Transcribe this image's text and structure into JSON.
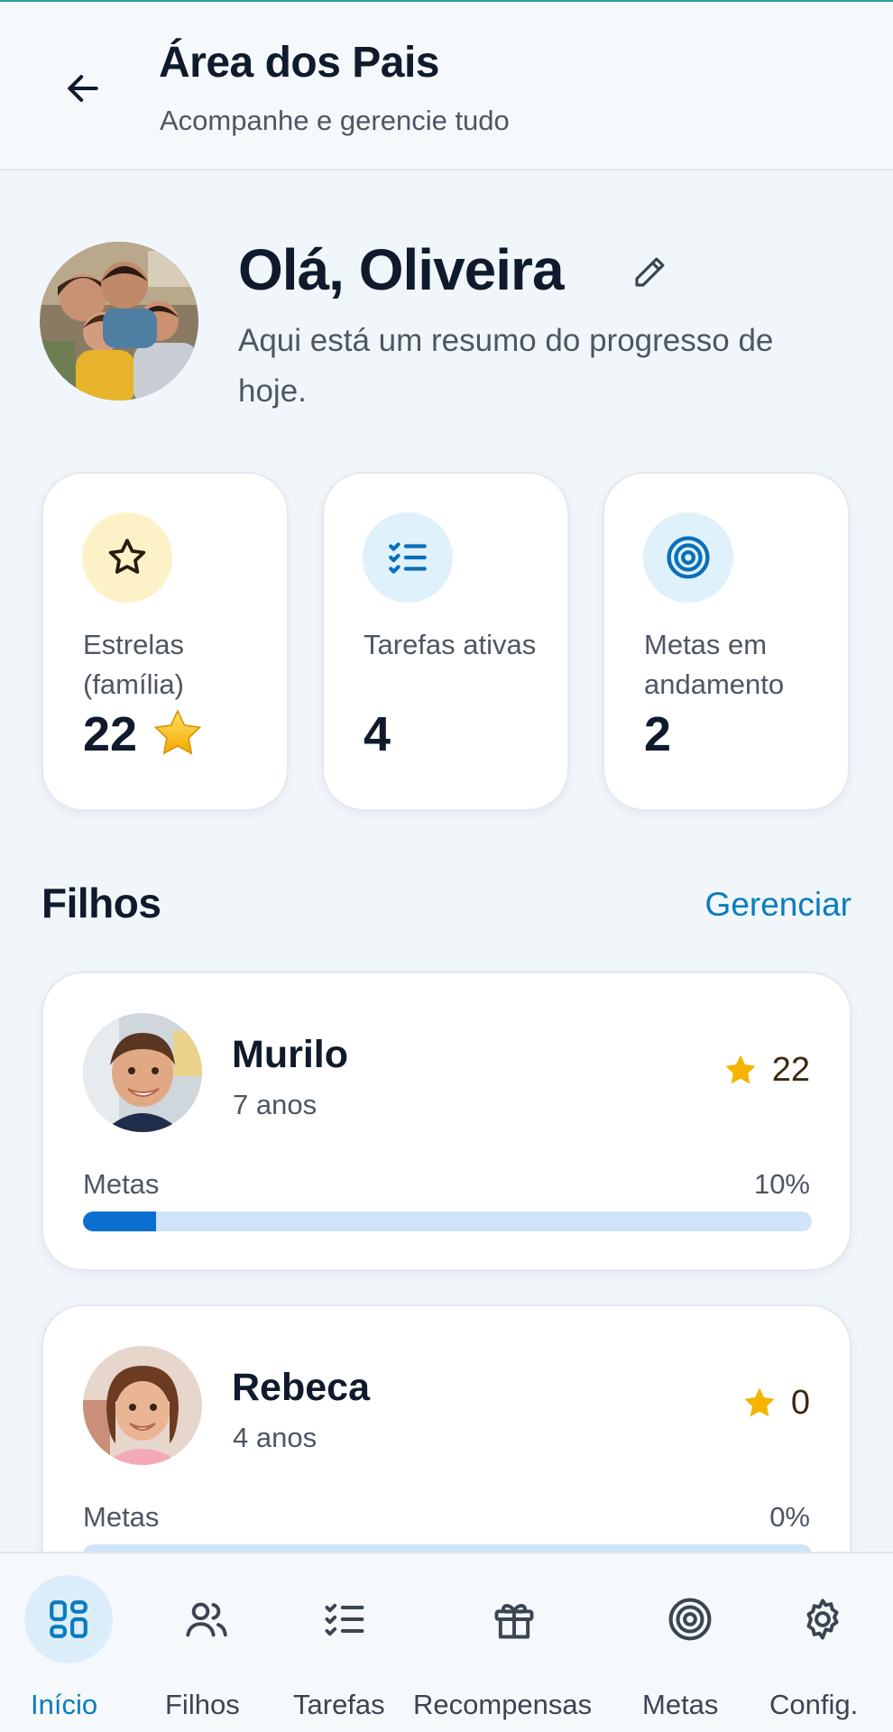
{
  "header": {
    "title": "Área dos Pais",
    "subtitle": "Acompanhe e gerencie tudo",
    "back_icon": "arrow-left-icon"
  },
  "greeting": {
    "title": "Olá, Oliveira",
    "subtitle": "Aqui está um resumo do progresso de hoje.",
    "edit_icon": "pencil-icon"
  },
  "stats": [
    {
      "label": "Estrelas (família)",
      "value": "22",
      "icon": "star-outline-icon",
      "icon_bg": "#fdf2c7",
      "value_icon": "star-filled-icon"
    },
    {
      "label": "Tarefas ativas",
      "value": "4",
      "icon": "checklist-icon",
      "icon_bg": "#dff1fb"
    },
    {
      "label": "Metas em andamento",
      "value": "2",
      "icon": "target-icon",
      "icon_bg": "#dff1fb"
    }
  ],
  "children_section": {
    "title": "Filhos",
    "manage_label": "Gerenciar"
  },
  "children": [
    {
      "name": "Murilo",
      "age": "7 anos",
      "stars": "22",
      "progress_label": "Metas",
      "progress_text": "10%",
      "progress": 0.1
    },
    {
      "name": "Rebeca",
      "age": "4 anos",
      "stars": "0",
      "progress_label": "Metas",
      "progress_text": "0%",
      "progress": 0.0
    }
  ],
  "bottom_nav": [
    {
      "label": "Início",
      "icon": "grid-icon",
      "active": true
    },
    {
      "label": "Filhos",
      "icon": "users-icon",
      "active": false
    },
    {
      "label": "Tarefas",
      "icon": "checklist-icon",
      "active": false
    },
    {
      "label": "Recompensas",
      "icon": "gift-icon",
      "active": false
    },
    {
      "label": "Metas",
      "icon": "target-icon",
      "active": false
    },
    {
      "label": "Config.",
      "icon": "gear-icon",
      "active": false
    }
  ],
  "colors": {
    "accent": "#0a7bbf",
    "progress_fill": "#0a6fd1",
    "progress_track": "#cfe4f7",
    "star": "#f5b400"
  }
}
